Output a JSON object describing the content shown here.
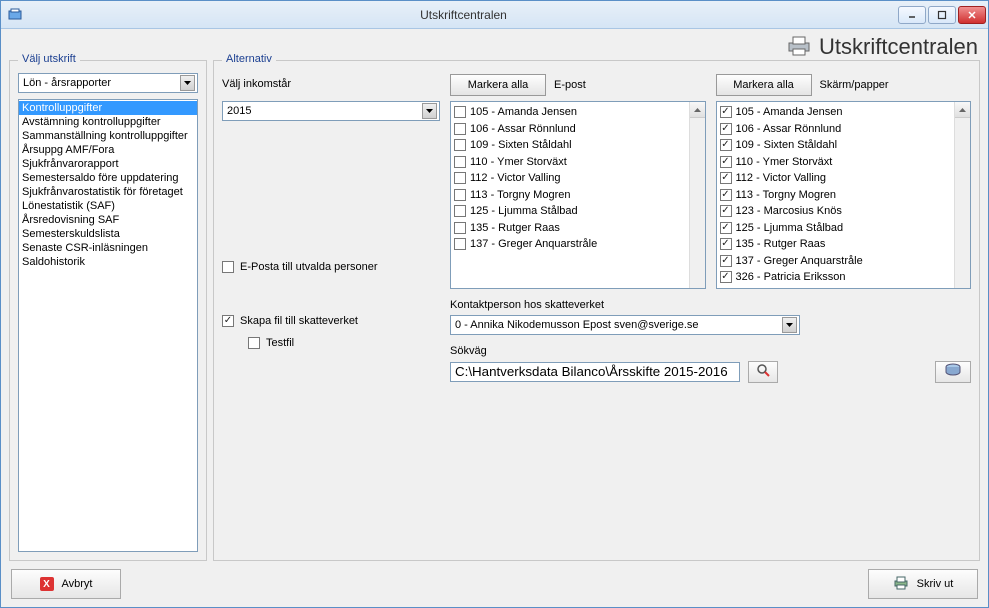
{
  "window": {
    "title": "Utskriftcentralen"
  },
  "header": {
    "text": "Utskriftcentralen"
  },
  "left": {
    "group_label": "Välj utskrift",
    "dropdown_value": "Lön - årsrapporter",
    "items": [
      "Kontrolluppgifter",
      "Avstämning kontrolluppgifter",
      "Sammanställning kontrolluppgifter",
      "Årsuppg AMF/Fora",
      "Sjukfrånvarorapport",
      "Semestersaldo före uppdatering",
      "Sjukfrånvarostatistik för företaget",
      "Lönestatistik (SAF)",
      "Årsredovisning SAF",
      "Semesterskuldslista",
      "Senaste CSR-inläsningen",
      "Saldohistorik"
    ],
    "selected_index": 0
  },
  "alt": {
    "group_label": "Alternativ",
    "income_year_label": "Välj inkomstår",
    "income_year_value": "2015",
    "eposta_checkbox_label": "E-Posta till utvalda personer",
    "eposta_checked": false,
    "mark_all_label": "Markera alla",
    "epost_header": "E-post",
    "skarm_header": "Skärm/papper",
    "epost_list": [
      {
        "label": "105 - Amanda Jensen",
        "checked": false
      },
      {
        "label": "106 - Assar Rönnlund",
        "checked": false
      },
      {
        "label": "109 - Sixten Ståldahl",
        "checked": false
      },
      {
        "label": "110 - Ymer Storväxt",
        "checked": false
      },
      {
        "label": "112 - Victor Valling",
        "checked": false
      },
      {
        "label": "113 - Torgny Mogren",
        "checked": false
      },
      {
        "label": "125 - Ljumma Stålbad",
        "checked": false
      },
      {
        "label": "135 - Rutger Raas",
        "checked": false
      },
      {
        "label": "137 - Greger Anquarstråle",
        "checked": false
      }
    ],
    "skarm_list": [
      {
        "label": "105 - Amanda Jensen",
        "checked": true
      },
      {
        "label": "106 - Assar Rönnlund",
        "checked": true
      },
      {
        "label": "109 - Sixten Ståldahl",
        "checked": true
      },
      {
        "label": "110 - Ymer Storväxt",
        "checked": true
      },
      {
        "label": "112 - Victor Valling",
        "checked": true
      },
      {
        "label": "113 - Torgny Mogren",
        "checked": true
      },
      {
        "label": "123 - Marcosius Knös",
        "checked": true
      },
      {
        "label": "125 - Ljumma Stålbad",
        "checked": true
      },
      {
        "label": "135 - Rutger Raas",
        "checked": true
      },
      {
        "label": "137 - Greger Anquarstråle",
        "checked": true
      },
      {
        "label": "326 - Patricia Eriksson",
        "checked": true
      }
    ],
    "skapa_fil_label": "Skapa fil till skatteverket",
    "skapa_fil_checked": true,
    "testfil_label": "Testfil",
    "testfil_checked": false,
    "kontakt_label": "Kontaktperson hos skatteverket",
    "kontakt_value": "0 - Annika Nikodemusson Epost sven@sverige.se",
    "sokvag_label": "Sökväg",
    "sokvag_value": "C:\\Hantverksdata Bilanco\\Årsskifte 2015-2016"
  },
  "footer": {
    "cancel_label": "Avbryt",
    "print_label": "Skriv ut"
  }
}
